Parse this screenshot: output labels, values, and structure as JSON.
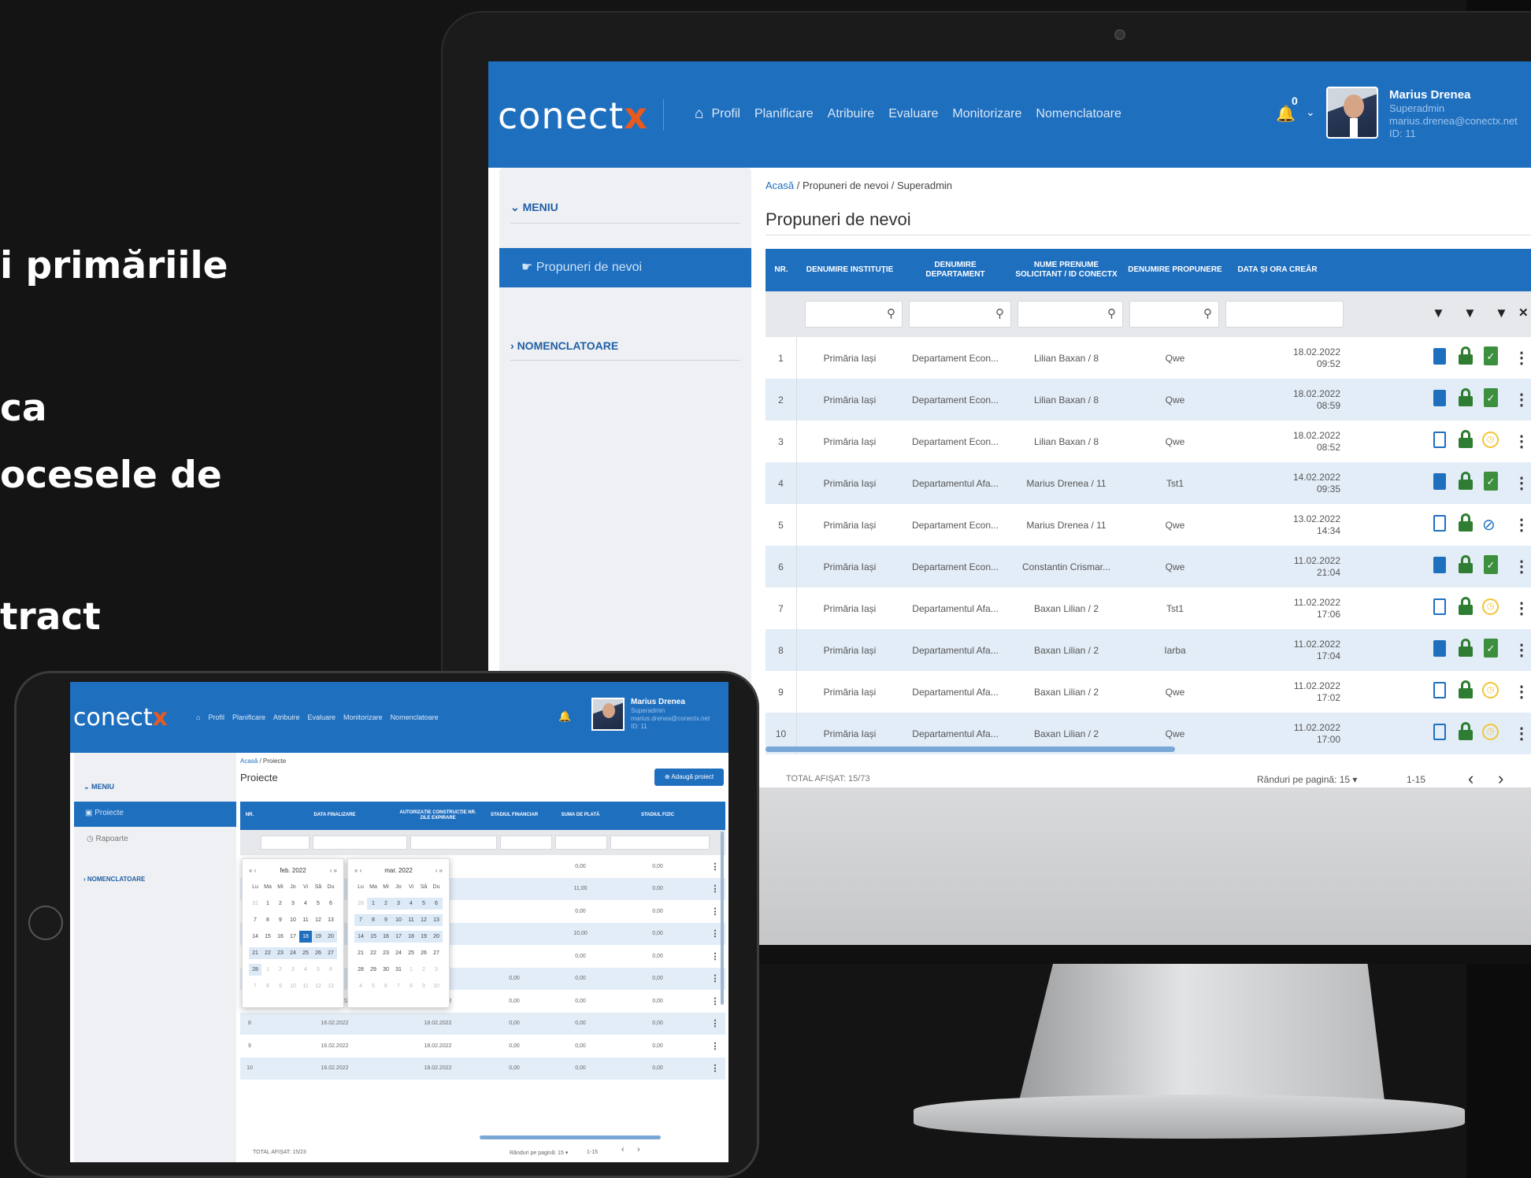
{
  "promo": {
    "lines": [
      "i primăriile",
      "ca",
      "ocesele de",
      "tract"
    ]
  },
  "desktop": {
    "logo": {
      "main": "conect",
      "accent": "x"
    },
    "nav": [
      "Profil",
      "Planificare",
      "Atribuire",
      "Evaluare",
      "Monitorizare",
      "Nomenclatoare"
    ],
    "notifications": "0",
    "user": {
      "name": "Marius Drenea",
      "role": "Superadmin",
      "email": "marius.drenea@conectx.net",
      "id": "ID: 11"
    },
    "sidebar": {
      "menu": "MENIU",
      "active": "Propuneri de nevoi",
      "nomenclatoare": "NOMENCLATOARE"
    },
    "breadcrumb": {
      "home": "Acasă",
      "rest": " / Propuneri de nevoi / Superadmin"
    },
    "title": "Propuneri de nevoi",
    "columns": [
      "NR.",
      "DENUMIRE INSTITUȚIE",
      "DENUMIRE DEPARTAMENT",
      "NUME PRENUME SOLICITANT / ID CONECTX",
      "DENUMIRE PROPUNERE",
      "DATA ȘI ORA CREĂR"
    ],
    "rows": [
      {
        "nr": "1",
        "inst": "Primăria Iași",
        "dep": "Departament Econ...",
        "sol": "Lilian Baxan / 8",
        "prop": "Qwe",
        "date": "18.02.2022",
        "time": "09:52",
        "doc": "filled",
        "status": "approved"
      },
      {
        "nr": "2",
        "inst": "Primăria Iași",
        "dep": "Departament Econ...",
        "sol": "Lilian Baxan / 8",
        "prop": "Qwe",
        "date": "18.02.2022",
        "time": "08:59",
        "doc": "filled",
        "status": "approved"
      },
      {
        "nr": "3",
        "inst": "Primăria Iași",
        "dep": "Departament Econ...",
        "sol": "Lilian Baxan / 8",
        "prop": "Qwe",
        "date": "18.02.2022",
        "time": "08:52",
        "doc": "outline",
        "status": "pending"
      },
      {
        "nr": "4",
        "inst": "Primăria Iași",
        "dep": "Departamentul Afa...",
        "sol": "Marius Drenea / 11",
        "prop": "Tst1",
        "date": "14.02.2022",
        "time": "09:35",
        "doc": "filled",
        "status": "approved"
      },
      {
        "nr": "5",
        "inst": "Primăria Iași",
        "dep": "Departament Econ...",
        "sol": "Marius Drenea / 11",
        "prop": "Qwe",
        "date": "13.02.2022",
        "time": "14:34",
        "doc": "outline",
        "status": "hidden"
      },
      {
        "nr": "6",
        "inst": "Primăria Iași",
        "dep": "Departament Econ...",
        "sol": "Constantin Crismar...",
        "prop": "Qwe",
        "date": "11.02.2022",
        "time": "21:04",
        "doc": "filled",
        "status": "approved"
      },
      {
        "nr": "7",
        "inst": "Primăria Iași",
        "dep": "Departamentul Afa...",
        "sol": "Baxan Lilian / 2",
        "prop": "Tst1",
        "date": "11.02.2022",
        "time": "17:06",
        "doc": "outline",
        "status": "pending"
      },
      {
        "nr": "8",
        "inst": "Primăria Iași",
        "dep": "Departamentul Afa...",
        "sol": "Baxan Lilian / 2",
        "prop": "Iarba",
        "date": "11.02.2022",
        "time": "17:04",
        "doc": "filled",
        "status": "approved"
      },
      {
        "nr": "9",
        "inst": "Primăria Iași",
        "dep": "Departamentul Afa...",
        "sol": "Baxan Lilian / 2",
        "prop": "Qwe",
        "date": "11.02.2022",
        "time": "17:02",
        "doc": "outline",
        "status": "pending"
      },
      {
        "nr": "10",
        "inst": "Primăria Iași",
        "dep": "Departamentul Afa...",
        "sol": "Baxan Lilian / 2",
        "prop": "Qwe",
        "date": "11.02.2022",
        "time": "17:00",
        "doc": "outline",
        "status": "pending"
      }
    ],
    "footer": {
      "total": "TOTAL AFIȘAT: 15/73",
      "rows_per_page": "Rânduri pe pagină: 15 ▾",
      "range": "1-15"
    }
  },
  "tablet": {
    "logo": {
      "main": "conect",
      "accent": "x"
    },
    "nav": [
      "Profil",
      "Planificare",
      "Atribuire",
      "Evaluare",
      "Monitorizare",
      "Nomenclatoare"
    ],
    "user": {
      "name": "Marius Drenea",
      "role": "Superadmin",
      "email": "marius.drenea@conectx.net",
      "id": "ID: 11"
    },
    "sidebar": {
      "menu": "MENIU",
      "active": "Proiecte",
      "rapoarte": "Rapoarte",
      "nomenclatoare": "NOMENCLATOARE"
    },
    "breadcrumb": {
      "home": "Acasă",
      "rest": " / Proiecte"
    },
    "title": "Proiecte",
    "add_button": "Adaugă proiect",
    "columns": [
      "NR.",
      "DATA FINALIZARE",
      "AUTORIZAȚIE CONSTRUCȚIE NR. ZILE EXPIRARE",
      "STADIUL FINANCIAR",
      "SUMA DE PLATĂ",
      "STADIUL FIZIC"
    ],
    "calendar_left": {
      "title": "feb. 2022",
      "days": [
        "Lu",
        "Ma",
        "Mi",
        "Jo",
        "Vi",
        "Sâ",
        "Du"
      ],
      "cells": [
        "31",
        "1",
        "2",
        "3",
        "4",
        "5",
        "6",
        "7",
        "8",
        "9",
        "10",
        "11",
        "12",
        "13",
        "14",
        "15",
        "16",
        "17",
        "18",
        "19",
        "20",
        "21",
        "22",
        "23",
        "24",
        "25",
        "26",
        "27",
        "28",
        "1",
        "2",
        "3",
        "4",
        "5",
        "6",
        "7",
        "8",
        "9",
        "10",
        "11",
        "12",
        "13"
      ]
    },
    "calendar_right": {
      "title": "mar. 2022",
      "days": [
        "Lu",
        "Ma",
        "Mi",
        "Jo",
        "Vi",
        "Sâ",
        "Du"
      ],
      "cells": [
        "28",
        "1",
        "2",
        "3",
        "4",
        "5",
        "6",
        "7",
        "8",
        "9",
        "10",
        "11",
        "12",
        "13",
        "14",
        "15",
        "16",
        "17",
        "18",
        "19",
        "20",
        "21",
        "22",
        "23",
        "24",
        "25",
        "26",
        "27",
        "28",
        "29",
        "30",
        "31",
        "1",
        "2",
        "3",
        "4",
        "5",
        "6",
        "7",
        "8",
        "9",
        "10"
      ]
    },
    "rows": [
      {
        "nr": "1",
        "a": "",
        "b": "",
        "c": "",
        "d": "0,00",
        "e": "0,00"
      },
      {
        "nr": "2",
        "a": "",
        "b": "",
        "c": "",
        "d": "11,00",
        "e": "0,00"
      },
      {
        "nr": "3",
        "a": "",
        "b": "",
        "c": "",
        "d": "0,00",
        "e": "0,00"
      },
      {
        "nr": "4",
        "a": "",
        "b": "",
        "c": "",
        "d": "10,00",
        "e": "0,00"
      },
      {
        "nr": "5",
        "a": "",
        "b": "",
        "c": "",
        "d": "0,00",
        "e": "0,00"
      },
      {
        "nr": "6",
        "a": "",
        "b": "",
        "c": "0,00",
        "d": "0,00",
        "e": "0,00"
      },
      {
        "nr": "7",
        "a": "16.02.2022",
        "b": "18.02.2022",
        "c": "0,00",
        "d": "0,00",
        "e": "0,00"
      },
      {
        "nr": "8",
        "a": "16.02.2022",
        "b": "18.02.2022",
        "c": "0,00",
        "d": "0,00",
        "e": "0,00"
      },
      {
        "nr": "9",
        "a": "16.02.2022",
        "b": "18.02.2022",
        "c": "0,00",
        "d": "0,00",
        "e": "0,00"
      },
      {
        "nr": "10",
        "a": "16.02.2022",
        "b": "18.02.2022",
        "c": "0,00",
        "d": "0,00",
        "e": "0,00"
      }
    ],
    "footer": {
      "total": "TOTAL AFIȘAT: 15/23",
      "rows_per_page": "Rânduri pe pagină: 15 ▾",
      "range": "1-15"
    }
  }
}
